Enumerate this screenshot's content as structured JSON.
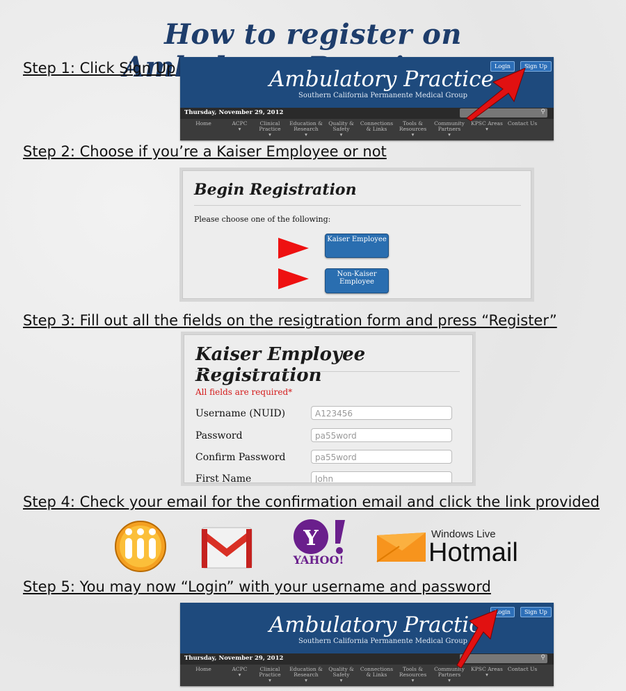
{
  "title": "How to register on AmbulatoryPractice.org",
  "steps": [
    "Step 1: Click Sign Up",
    "Step 2: Choose if you’re a Kaiser Employee or not",
    "Step 3: Fill out all the fields on the resigtration form and press “Register”",
    "Step 4: Check your email for the confirmation email and click the link provided",
    "Step 5: You may now “Login” with your username and password"
  ],
  "site_header": {
    "brand": "Ambulatory Practice",
    "subtitle": "Southern California    Permanente Medical Group",
    "login": "Login",
    "signup": "Sign Up",
    "date": "Thursday, November 29, 2012",
    "search_icon": "⚲",
    "nav": [
      "Home",
      "ACPC\n▾",
      "Clinical\nPractice\n▾",
      "Education &\nResearch\n▾",
      "Quality &\nSafety\n▾",
      "Connections\n& Links",
      "Tools &\nResources\n▾",
      "Community\nPartners\n▾",
      "KPSC Areas\n▾",
      "Contact Us"
    ]
  },
  "begin_registration": {
    "heading": "Begin Registration",
    "prompt": "Please choose one of the following:",
    "kaiser_button": "Kaiser Employee",
    "non_kaiser_button": "Non-Kaiser\nEmployee"
  },
  "kaiser_form": {
    "heading": "Kaiser Employee Registration",
    "required_note": "All fields are required*",
    "fields": [
      {
        "label": "Username (NUID)",
        "placeholder": "A123456"
      },
      {
        "label": "Password",
        "placeholder": "pa55word"
      },
      {
        "label": "Confirm Password",
        "placeholder": "pa55word"
      },
      {
        "label": "First Name",
        "placeholder": "John"
      }
    ]
  },
  "email_providers": {
    "yahoo": "YAHOO!",
    "hotmail_top": "Windows Live",
    "hotmail": "Hotmail"
  },
  "colors": {
    "title": "#1e3d6b",
    "header_blue": "#1e4a7d",
    "arrow_red": "#e11111",
    "required_red": "#d41a1a"
  }
}
